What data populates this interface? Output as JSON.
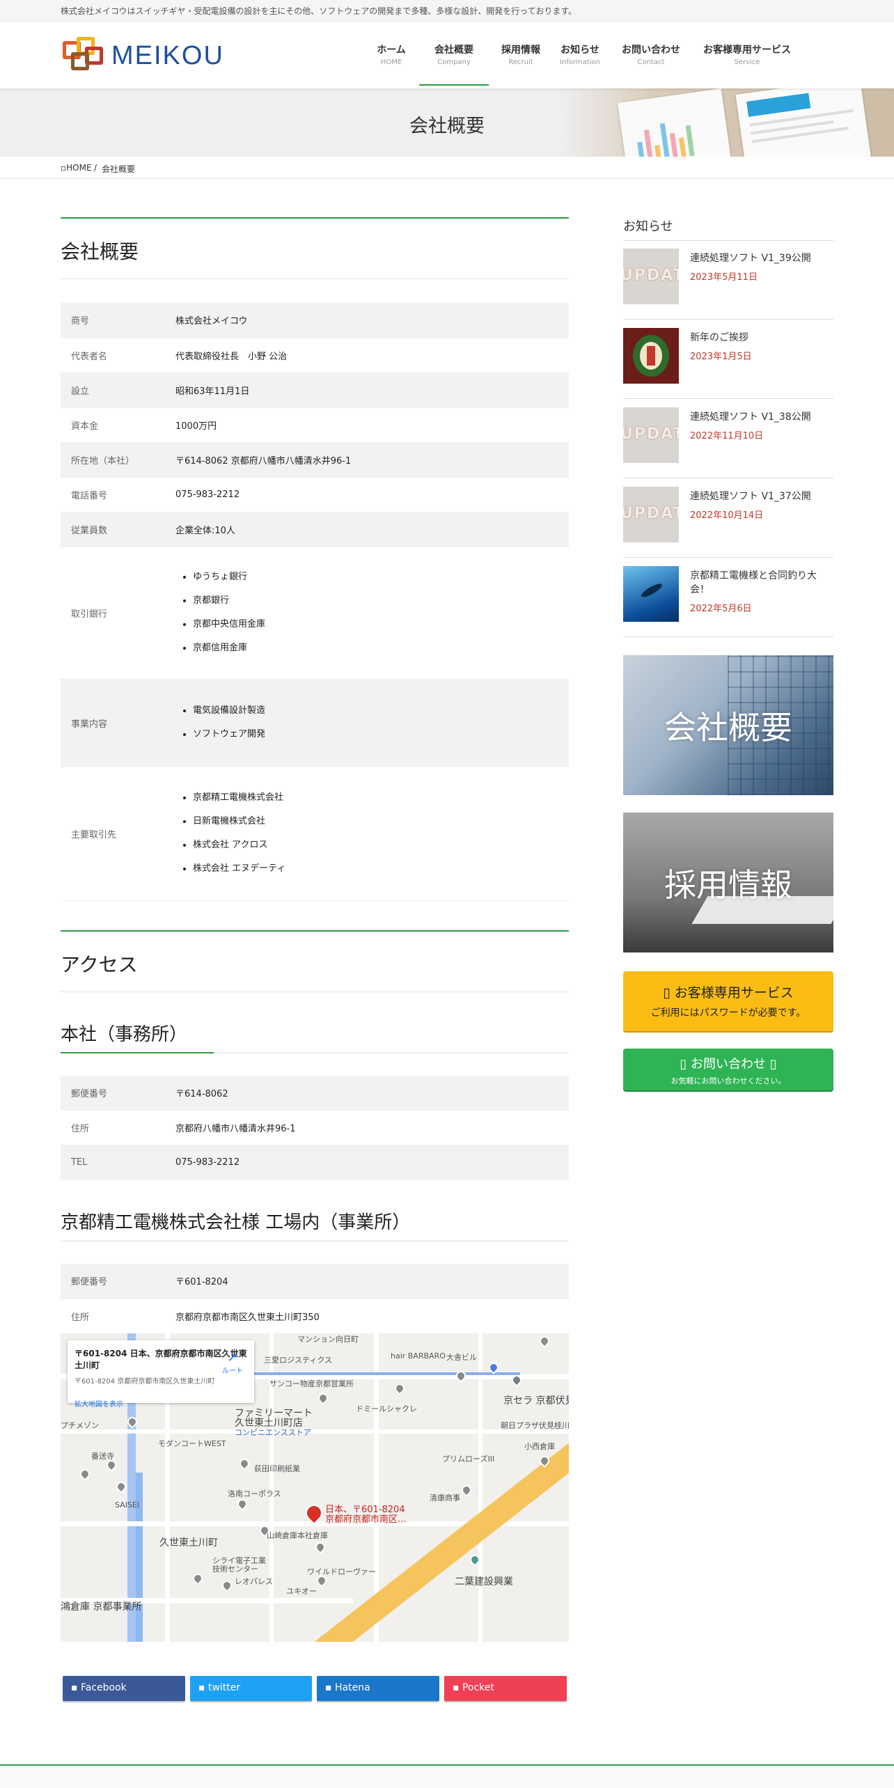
{
  "topbar": {
    "text": "株式会社メイコウはスイッチギヤ・受配電設備の設計を主にその他、ソフトウェアの開発まで多種、多様な設計、開発を行っております。"
  },
  "logo": {
    "text": "MEIKOU"
  },
  "nav": [
    {
      "label": "ホーム",
      "sub": "HOME"
    },
    {
      "label": "会社概要",
      "sub": "Company"
    },
    {
      "label": "採用情報",
      "sub": "Recruit"
    },
    {
      "label": "お知らせ",
      "sub": "Information"
    },
    {
      "label": "お問い合わせ",
      "sub": "Contact"
    },
    {
      "label": "お客様専用サービス",
      "sub": "Service"
    }
  ],
  "page": {
    "title": "会社概要"
  },
  "breadcrumb": {
    "home": "HOME",
    "sep": "/",
    "current": "会社概要"
  },
  "company": {
    "title": "会社概要",
    "rows": [
      {
        "key": "商号",
        "value": "株式会社メイコウ"
      },
      {
        "key": "代表者名",
        "value": "代表取締役社長　小野 公治"
      },
      {
        "key": "設立",
        "value": "昭和63年11月1日"
      },
      {
        "key": "資本金",
        "value": "1000万円"
      },
      {
        "key": "所在地（本社）",
        "value": "〒614-8062 京都府八幡市八幡清水井96-1"
      },
      {
        "key": "電話番号",
        "value": "075-983-2212"
      },
      {
        "key": "従業員数",
        "value": "企業全体:10人"
      }
    ],
    "banks_key": "取引銀行",
    "banks": [
      "ゆうちょ銀行",
      "京都銀行",
      "京都中央信用金庫",
      "京都信用金庫"
    ],
    "business_key": "事業内容",
    "business": [
      "電気設備設計製造",
      "ソフトウェア開発"
    ],
    "clients_key": "主要取引先",
    "clients": [
      "京都精工電機株式会社",
      "日新電機株式会社",
      "株式会社 アクロス",
      "株式会社 エヌデーティ"
    ]
  },
  "access": {
    "title": "アクセス",
    "hq": {
      "title": "本社（事務所）",
      "rows": [
        {
          "key": "郵便番号",
          "value": "〒614-8062"
        },
        {
          "key": "住所",
          "value": "京都府八幡市八幡清水井96-1"
        },
        {
          "key": "TEL",
          "value": "075-983-2212"
        }
      ]
    },
    "office": {
      "title": "京都精工電機株式会社様 工場内（事業所）",
      "rows": [
        {
          "key": "郵便番号",
          "value": "〒601-8204"
        },
        {
          "key": "住所",
          "value": "京都府京都市南区久世東土川町350"
        }
      ]
    }
  },
  "map": {
    "card_title": "〒601-8204 日本、京都府京都市南区久世東土川町",
    "card_addr": "〒601-8204 京都府京都市南区久世東土川町",
    "card_link": "拡大地図を表示",
    "card_dir": "ルート",
    "labels": [
      "マンション向日町",
      "三愛ロジスティクス",
      "hair BARBARO",
      "大舎ビル",
      "京セラ 京都伏見",
      "サンコー物産京都営業所",
      "ドミールシャクレ",
      "ファミリーマート",
      "久世東土川町店",
      "コンビニエンスストア",
      "朝日プラザ伏見桂川",
      "小西倉庫",
      "プチメゾン",
      "モダンコートWEST",
      "番送寺",
      "荻田印刷紙業",
      "プリムローズIII",
      "洛南コーポラス",
      "SAISEI",
      "日本、〒601-8204",
      "京都府京都市南区…",
      "清康商事",
      "山崎倉庫本社倉庫",
      "久世東土川町",
      "シライ電子工業",
      "技術センター",
      "ワイルドローヴァー",
      "レオパレス",
      "ユキオー",
      "二葉建設興業",
      "鴻倉庫 京都事業所"
    ]
  },
  "share": [
    {
      "label": "Facebook",
      "color": "#3b5998"
    },
    {
      "label": "twitter",
      "color": "#1da1f2"
    },
    {
      "label": "Hatena",
      "color": "#1a77c9"
    },
    {
      "label": "Pocket",
      "color": "#ef4056"
    }
  ],
  "sidebar": {
    "title": "お知らせ",
    "news": [
      {
        "title": "連続処理ソフト V1_39公開",
        "date": "2023年5月11日",
        "thumb": "update-thumbnail"
      },
      {
        "title": "新年のご挨拶",
        "date": "2023年1月5日",
        "thumb": "new-year-wreath-thumbnail"
      },
      {
        "title": "連続処理ソフト V1_38公開",
        "date": "2022年11月10日",
        "thumb": "update-thumbnail"
      },
      {
        "title": "連続処理ソフト V1_37公開",
        "date": "2022年10月14日",
        "thumb": "update-thumbnail"
      },
      {
        "title": "京都精工電機様と合同釣り大会！",
        "date": "2022年5月6日",
        "thumb": "underwater-thumbnail"
      }
    ],
    "banner_company": "会社概要",
    "banner_recruit": "採用情報",
    "service_btn": {
      "title": "お客様専用サービス",
      "sub": "ご利用にはパスワードが必要です。"
    },
    "contact_btn": {
      "title": "お問い合わせ",
      "sub": "お気軽にお問い合わせください。"
    }
  },
  "colors": {
    "accent": "#2e9b48",
    "date": "#c0392b",
    "service": "#fbbd14",
    "contact": "#2eb454",
    "logo": "#1d4fa0"
  }
}
